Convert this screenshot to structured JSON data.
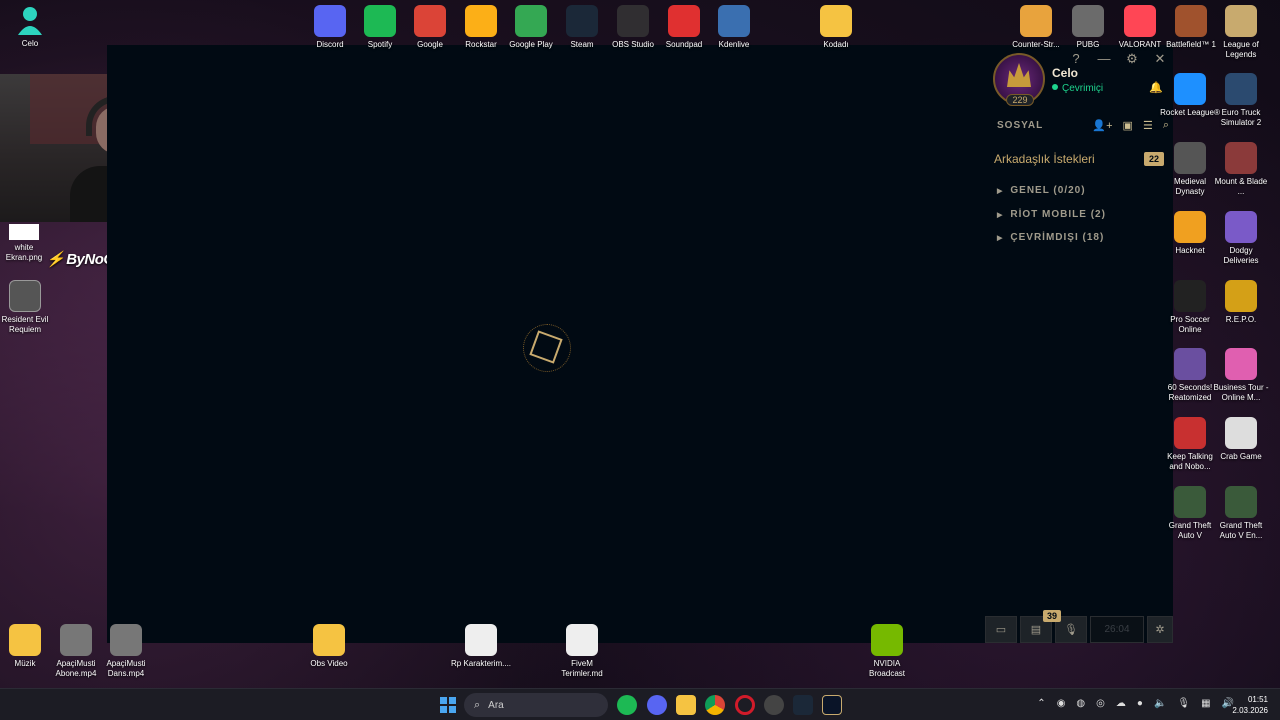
{
  "desktop_left": [
    {
      "label": "Celo",
      "icon": "user-icon",
      "color": "#2dd4bf"
    },
    {
      "label": "white\nEkran.png",
      "icon": "image-file-icon",
      "color": "#ffffff"
    },
    {
      "label": "Resident Evil Requiem",
      "icon": "game-icon",
      "color": "#666666"
    }
  ],
  "bynogame_text": "ByNoGame",
  "desktop_top": [
    {
      "label": "Discord",
      "icon": "discord-icon",
      "color": "#5865f2"
    },
    {
      "label": "Spotify",
      "icon": "spotify-icon",
      "color": "#1db954"
    },
    {
      "label": "Google",
      "icon": "chrome-icon",
      "color": "#db4437"
    },
    {
      "label": "Rockstar",
      "icon": "rockstar-icon",
      "color": "#fcaf17"
    },
    {
      "label": "Google Play",
      "icon": "google-play-icon",
      "color": "#34a853"
    },
    {
      "label": "Steam",
      "icon": "steam-icon",
      "color": "#1b2838"
    },
    {
      "label": "OBS Studio",
      "icon": "obs-icon",
      "color": "#302e31"
    },
    {
      "label": "Soundpad",
      "icon": "soundpad-icon",
      "color": "#e03030"
    },
    {
      "label": "Kdenlive",
      "icon": "kdenlive-icon",
      "color": "#3a6fb0"
    },
    {
      "label": "Kodadı",
      "icon": "folder-icon",
      "color": "#f5c342"
    }
  ],
  "desktop_right_top": [
    {
      "label": "Counter-Str...",
      "icon": "csgo-icon",
      "color": "#e8a33d"
    },
    {
      "label": "PUBG",
      "icon": "pubg-icon",
      "color": "#6b6b6b"
    },
    {
      "label": "VALORANT",
      "icon": "valorant-icon",
      "color": "#ff4655"
    },
    {
      "label": "Battlefield™ 1",
      "icon": "battlefield-icon",
      "color": "#a0522d"
    },
    {
      "label": "League of Legends",
      "icon": "league-icon",
      "color": "#c8aa6e"
    }
  ],
  "desktop_right_col": [
    [
      {
        "label": "Rocket League®",
        "icon": "rocket-league-icon",
        "color": "#1e90ff"
      },
      {
        "label": "Euro Truck Simulator 2",
        "icon": "truck-icon",
        "color": "#2b4a6f"
      }
    ],
    [
      {
        "label": "Medieval Dynasty",
        "icon": "medieval-icon",
        "color": "#555555"
      },
      {
        "label": "Mount & Blade ...",
        "icon": "mount-blade-icon",
        "color": "#8b3a3a"
      }
    ],
    [
      {
        "label": "Hacknet",
        "icon": "hacknet-icon",
        "color": "#f0a020"
      },
      {
        "label": "Dodgy Deliveries",
        "icon": "dodgy-icon",
        "color": "#7a5ac8"
      }
    ],
    [
      {
        "label": "Pro Soccer Online",
        "icon": "soccer-icon",
        "color": "#222222"
      },
      {
        "label": "R.E.P.O.",
        "icon": "repo-icon",
        "color": "#d4a017"
      }
    ],
    [
      {
        "label": "60 Seconds! Reatomized",
        "icon": "sixty-seconds-icon",
        "color": "#6a4fa0"
      },
      {
        "label": "Business Tour - Online M...",
        "icon": "business-tour-icon",
        "color": "#e05fb0"
      }
    ],
    [
      {
        "label": "Keep Talking and Nobo...",
        "icon": "keep-talking-icon",
        "color": "#c83030"
      },
      {
        "label": "Crab Game",
        "icon": "crab-game-icon",
        "color": "#dddddd"
      }
    ],
    [
      {
        "label": "Grand Theft Auto V",
        "icon": "gta-icon",
        "color": "#3a5a3a"
      },
      {
        "label": "Grand Theft Auto V En...",
        "icon": "gta-icon",
        "color": "#3a5a3a"
      }
    ]
  ],
  "desktop_bottom": [
    {
      "label": "Müzik",
      "icon": "folder-icon",
      "color": "#f5c342"
    },
    {
      "label": "ApaçiMusti Abone.mp4",
      "icon": "video-file-icon",
      "color": "#777777"
    },
    {
      "label": "ApaçiMusti Dans.mp4",
      "icon": "video-file-icon",
      "color": "#777777"
    },
    {
      "label": "Obs Video",
      "icon": "folder-icon",
      "color": "#f5c342"
    },
    {
      "label": "Rp Karakterim....",
      "icon": "text-file-icon",
      "color": "#eeeeee"
    },
    {
      "label": "FiveM Terimler.md",
      "icon": "text-file-icon",
      "color": "#eeeeee"
    },
    {
      "label": "NVIDIA Broadcast",
      "icon": "nvidia-icon",
      "color": "#76b900"
    }
  ],
  "client": {
    "profile_name": "Celo",
    "status": "Çevrimiçi",
    "level": "229",
    "social_title": "SOSYAL",
    "friend_requests": "Arkadaşlık İstekleri",
    "friend_requests_count": "22",
    "groups": [
      "GENEL (0/20)",
      "RİOT MOBILE (2)",
      "ÇEVRİMDIŞI (18)"
    ],
    "window_controls": [
      "?",
      "—",
      "⚙",
      "✕"
    ],
    "notification_count": "39",
    "bottom_time": "26:04"
  },
  "taskbar": {
    "search_placeholder": "Ara",
    "time": "01:51",
    "date": "2.03.2026"
  }
}
